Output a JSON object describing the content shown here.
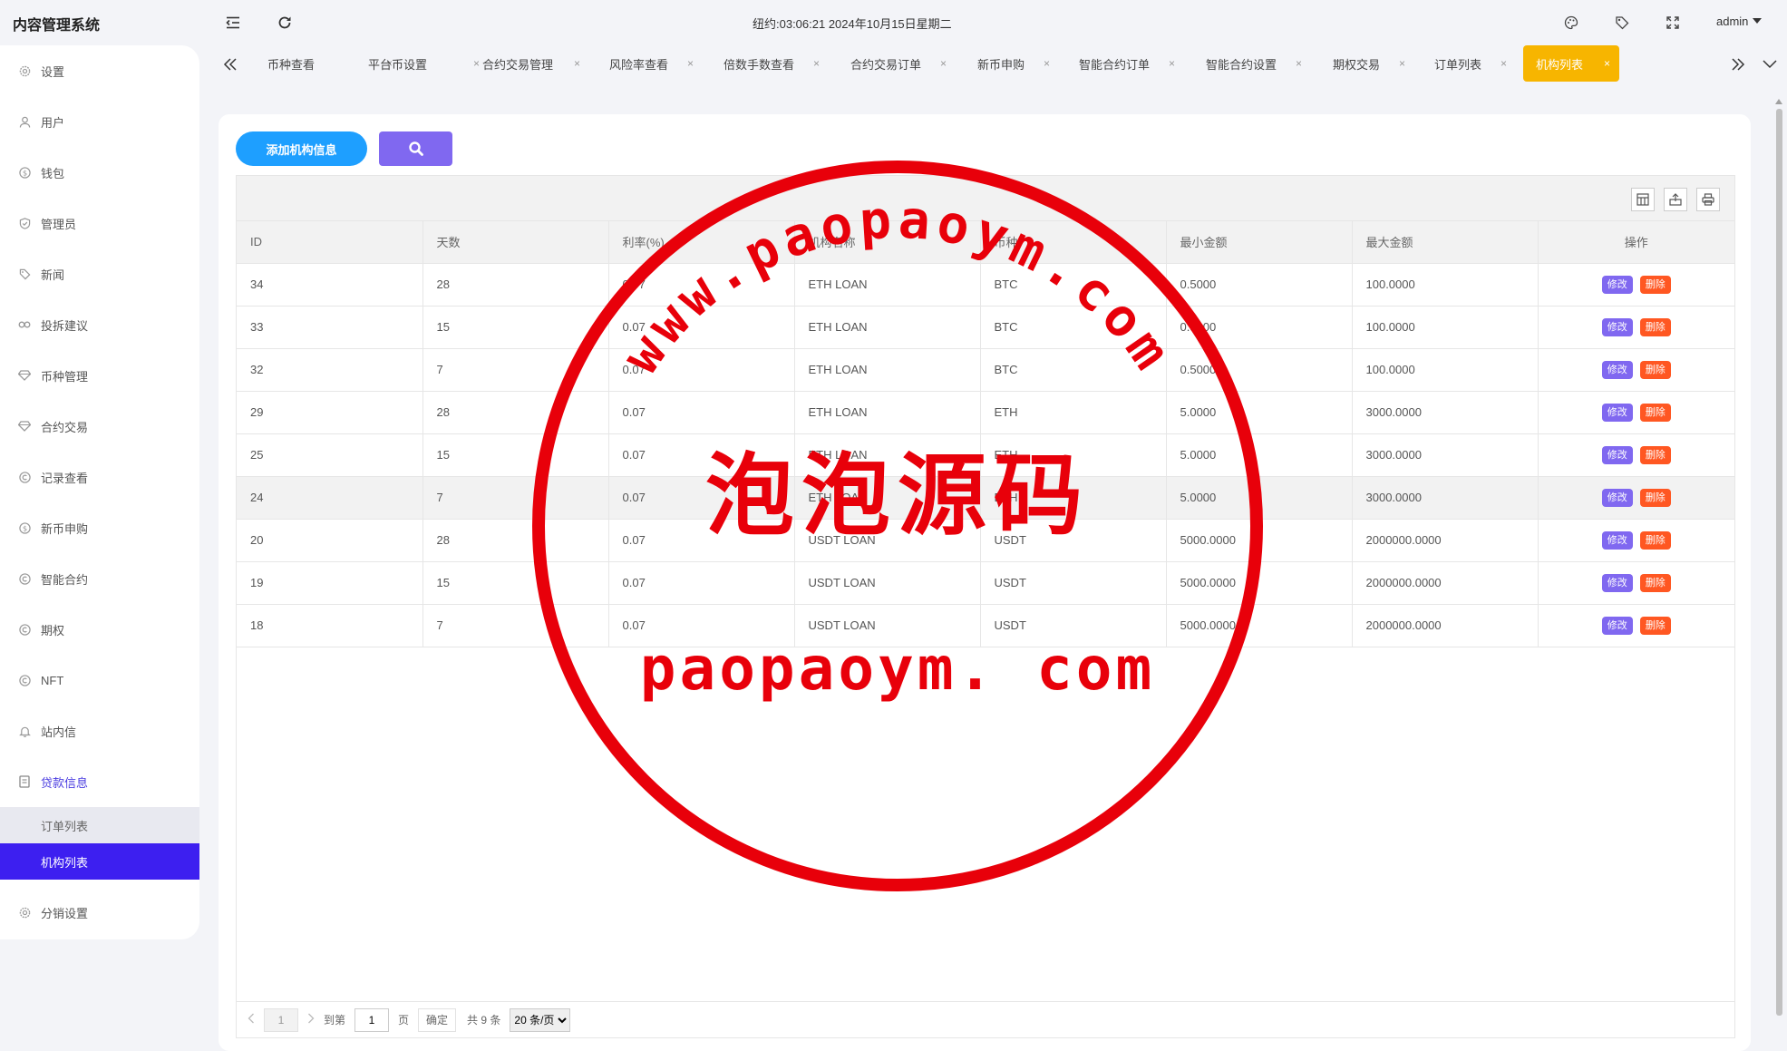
{
  "app": {
    "title": "内容管理系统"
  },
  "header": {
    "clock": "纽约:03:06:21 2024年10月15日星期二",
    "user": "admin"
  },
  "sidebar": {
    "items": [
      {
        "label": "设置",
        "icon": "gear-icon"
      },
      {
        "label": "用户",
        "icon": "user-icon"
      },
      {
        "label": "钱包",
        "icon": "dollar-icon"
      },
      {
        "label": "管理员",
        "icon": "shield-icon"
      },
      {
        "label": "新闻",
        "icon": "tag-icon"
      },
      {
        "label": "投拆建议",
        "icon": "link-icon"
      },
      {
        "label": "币种管理",
        "icon": "diamond-icon"
      },
      {
        "label": "合约交易",
        "icon": "diamond-icon"
      },
      {
        "label": "记录查看",
        "icon": "circle-c-icon"
      },
      {
        "label": "新币申购",
        "icon": "dollar-icon"
      },
      {
        "label": "智能合约",
        "icon": "circle-c-icon"
      },
      {
        "label": "期权",
        "icon": "circle-c-icon"
      },
      {
        "label": "NFT",
        "icon": "circle-c-icon"
      },
      {
        "label": "站内信",
        "icon": "bell-icon"
      },
      {
        "label": "贷款信息",
        "icon": "document-icon"
      }
    ],
    "sub_items": [
      {
        "label": "订单列表"
      },
      {
        "label": "机构列表"
      }
    ],
    "bottom_item": {
      "label": "分销设置",
      "icon": "gear-icon"
    }
  },
  "tabs": [
    {
      "label": "币种查看"
    },
    {
      "label": "平台币设置"
    },
    {
      "label": "合约交易管理"
    },
    {
      "label": "风险率查看"
    },
    {
      "label": "倍数手数查看"
    },
    {
      "label": "合约交易订单"
    },
    {
      "label": "新币申购"
    },
    {
      "label": "智能合约订单"
    },
    {
      "label": "智能合约设置"
    },
    {
      "label": "期权交易"
    },
    {
      "label": "订单列表"
    },
    {
      "label": "机构列表"
    }
  ],
  "toolbar": {
    "add_label": "添加机构信息"
  },
  "table": {
    "headers": [
      "ID",
      "天数",
      "利率(%)",
      "机构名称",
      "币种",
      "最小金额",
      "最大金额",
      "操作"
    ],
    "rows": [
      [
        "34",
        "28",
        "0.07",
        "ETH LOAN",
        "BTC",
        "0.5000",
        "100.0000"
      ],
      [
        "33",
        "15",
        "0.07",
        "ETH LOAN",
        "BTC",
        "0.5000",
        "100.0000"
      ],
      [
        "32",
        "7",
        "0.07",
        "ETH LOAN",
        "BTC",
        "0.5000",
        "100.0000"
      ],
      [
        "29",
        "28",
        "0.07",
        "ETH LOAN",
        "ETH",
        "5.0000",
        "3000.0000"
      ],
      [
        "25",
        "15",
        "0.07",
        "ETH LOAN",
        "ETH",
        "5.0000",
        "3000.0000"
      ],
      [
        "24",
        "7",
        "0.07",
        "ETH LOAN",
        "ETH",
        "5.0000",
        "3000.0000"
      ],
      [
        "20",
        "28",
        "0.07",
        "USDT LOAN",
        "USDT",
        "5000.0000",
        "2000000.0000"
      ],
      [
        "19",
        "15",
        "0.07",
        "USDT LOAN",
        "USDT",
        "5000.0000",
        "2000000.0000"
      ],
      [
        "18",
        "7",
        "0.07",
        "USDT LOAN",
        "USDT",
        "5000.0000",
        "2000000.0000"
      ]
    ],
    "edit_label": "修改",
    "delete_label": "删除"
  },
  "pagination": {
    "current": "1",
    "goto_label": "到第",
    "goto_value": "1",
    "page_unit": "页",
    "confirm": "确定",
    "total": "共 9 条",
    "page_size": "20 条/页"
  },
  "watermark": {
    "arc_text": "www.paopaoym.com",
    "center_text": "泡泡源码",
    "bottom_text": "paopaoym. com",
    "color": "#e8000a"
  }
}
